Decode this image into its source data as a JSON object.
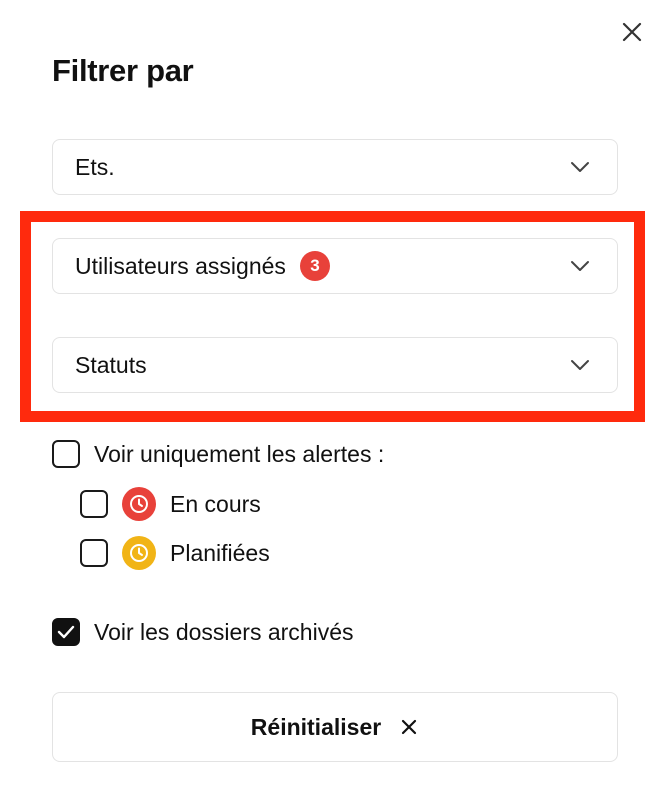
{
  "dialog": {
    "title": "Filtrer par",
    "close_icon": "close-icon"
  },
  "filters": {
    "establishment": {
      "label": "Ets.",
      "icon": "chevron-down-icon"
    },
    "assigned_users": {
      "label": "Utilisateurs assignés",
      "badge_count": "3",
      "icon": "chevron-down-icon"
    },
    "statuses": {
      "label": "Statuts",
      "icon": "chevron-down-icon"
    }
  },
  "alerts": {
    "only_alerts_label": "Voir uniquement les alertes :",
    "only_alerts_checked": false,
    "options": [
      {
        "label": "En cours",
        "checked": false,
        "icon": "clock-icon",
        "color": "#e8413a"
      },
      {
        "label": "Planifiées",
        "checked": false,
        "icon": "clock-icon",
        "color": "#f1b416"
      }
    ]
  },
  "archived": {
    "label": "Voir les dossiers archivés",
    "checked": true
  },
  "reset": {
    "label": "Réinitialiser",
    "icon": "close-icon"
  },
  "colors": {
    "highlight": "#ff2a0d",
    "badge": "#e8413a",
    "in_progress": "#e8413a",
    "planned": "#f1b416",
    "border": "#e3e3e3"
  }
}
